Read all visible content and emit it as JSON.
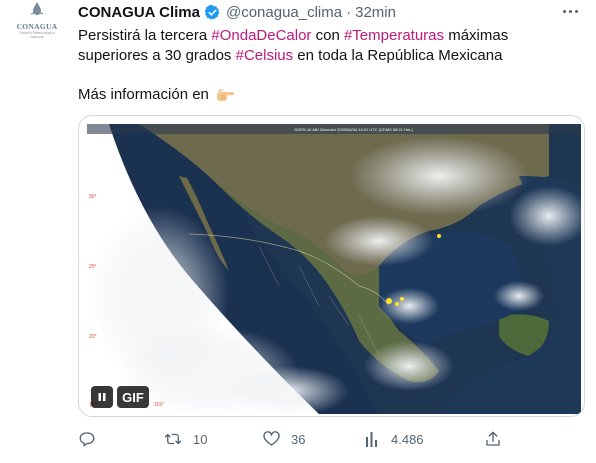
{
  "avatar": {
    "logo_text": "CONAGUA",
    "logo_sub": "Servicio Meteorológico Nacional",
    "icon": "water-drop-icon"
  },
  "author": {
    "name": "CONAGUA Clima",
    "handle": "@conagua_clima",
    "separator": "·",
    "time": "32min",
    "verified": true,
    "verified_icon": "verified-badge-icon"
  },
  "tweet": {
    "segments": [
      {
        "text": "Persistirá la tercera ",
        "hashtag": false
      },
      {
        "text": "#OndaDeCalor",
        "hashtag": true
      },
      {
        "text": " con ",
        "hashtag": false
      },
      {
        "text": "#Temperaturas",
        "hashtag": true
      },
      {
        "text": " máximas superiores a 30 grados ",
        "hashtag": false
      },
      {
        "text": "#Celsius",
        "hashtag": true
      },
      {
        "text": " en toda la República Mexicana",
        "hashtag": false
      }
    ],
    "more_info": "Más información en",
    "pointer_icon": "pointing-hand-emoji-icon"
  },
  "media": {
    "satellite_caption": "GOES-16 ABI Geocolor 2023/06/04 14:21 UTC (CDMX 08:21 Hrs.)",
    "lat_labels": [
      "30°",
      "25°",
      "20°",
      "15°"
    ],
    "lon_label": "115°",
    "gif_pause_icon": "pause-icon",
    "gif_label": "GIF"
  },
  "actions": {
    "reply": {
      "icon": "reply-icon",
      "count": ""
    },
    "retweet": {
      "icon": "retweet-icon",
      "count": "10"
    },
    "like": {
      "icon": "heart-icon",
      "count": "36"
    },
    "views": {
      "icon": "views-chart-icon",
      "count": "4.486"
    },
    "share": {
      "icon": "share-icon",
      "count": ""
    }
  },
  "colors": {
    "hashtag": "#c0197d",
    "secondary_text": "#536471",
    "verified": "#1d9bf0"
  }
}
